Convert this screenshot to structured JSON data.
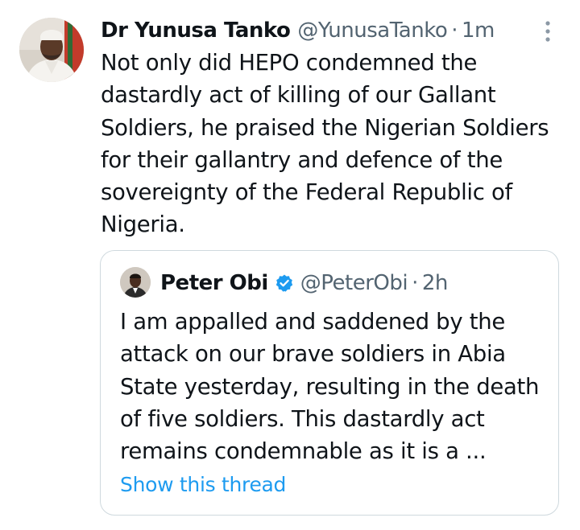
{
  "tweet": {
    "author_name": "Dr Yunusa Tanko",
    "author_handle": "@YunusaTanko",
    "separator": "·",
    "time": "1m",
    "text": "Not only did HEPO condemned the dastardly act of killing of our Gallant Soldiers, he praised the Nigerian Soldiers for their gallantry and defence of the sovereignty of the Federal Republic of Nigeria."
  },
  "quoted_tweet": {
    "author_name": "Peter Obi",
    "author_handle": "@PeterObi",
    "separator": "·",
    "time": "2h",
    "verified": true,
    "text": "I am appalled and saddened by the attack on our brave soldiers in Abia State yesterday, resulting in the death of five soldiers. This dastardly act remains condemnable as it is a ...",
    "show_thread_label": "Show this thread"
  },
  "colors": {
    "text_primary": "#0f1419",
    "text_secondary": "#536471",
    "link_blue": "#1d9bf0",
    "border": "#cfd9de"
  },
  "icons": {
    "more": "more-vertical-icon",
    "verified": "verified-badge-icon"
  }
}
